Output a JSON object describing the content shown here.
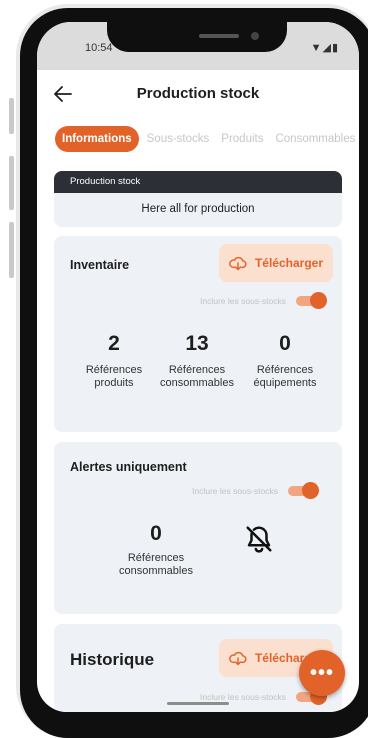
{
  "status": {
    "time": "10:54",
    "icons": "▼◢▮"
  },
  "appbar": {
    "title": "Production stock",
    "back_icon": "arrow-left-icon"
  },
  "tabs": [
    {
      "label": "Informations",
      "active": true
    },
    {
      "label": "Sous-stocks",
      "active": false
    },
    {
      "label": "Produits",
      "active": false
    },
    {
      "label": "Consommables",
      "active": false
    }
  ],
  "info": {
    "header": "Production stock",
    "body": "Here all for production"
  },
  "inventaire": {
    "title": "Inventaire",
    "download_label": "Télécharger",
    "toggle_label": "Inclure les sous-stocks",
    "toggle_on": true,
    "stats": [
      {
        "value": "2",
        "label_line1": "Références",
        "label_line2": "produits"
      },
      {
        "value": "13",
        "label_line1": "Références",
        "label_line2": "consommables"
      },
      {
        "value": "0",
        "label_line1": "Références",
        "label_line2": "équipements"
      }
    ]
  },
  "alertes": {
    "title": "Alertes uniquement",
    "toggle_label": "Inclure les sous-stocks",
    "toggle_on": true,
    "stat": {
      "value": "0",
      "label_line1": "Références",
      "label_line2": "consommables"
    },
    "icon": "bell-off-icon"
  },
  "historique": {
    "title": "Historique",
    "download_label": "Télécharger",
    "toggle_label": "Inclure les sous-stocks",
    "toggle_on": true
  },
  "fab": {
    "label": "•••"
  },
  "colors": {
    "accent": "#e2632a",
    "accent_light": "#fbdfcf",
    "card_bg": "#eef1f6",
    "dark_header": "#2c2f35"
  }
}
